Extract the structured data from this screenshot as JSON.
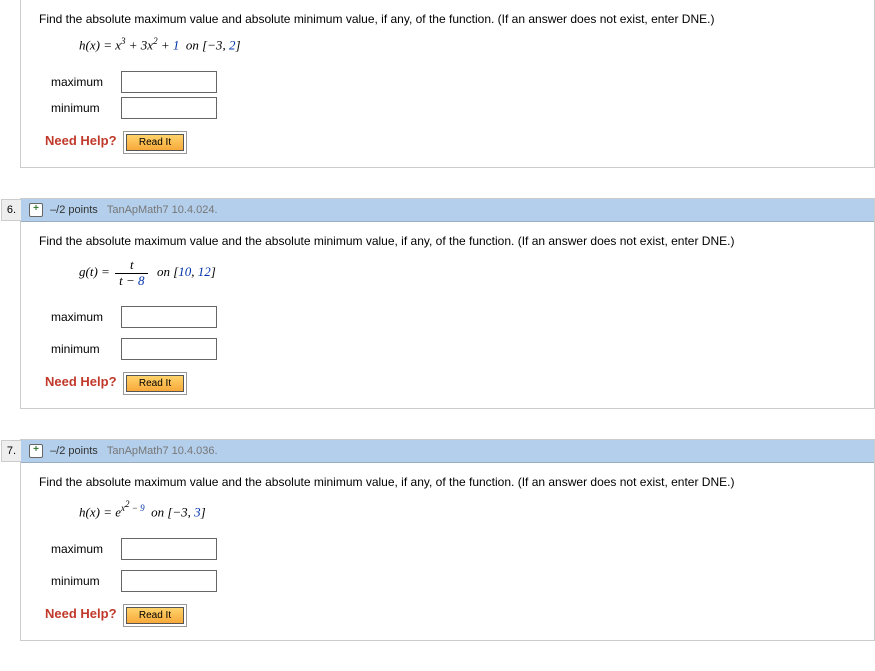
{
  "common": {
    "prompt_full": "Find the absolute maximum value and the absolute minimum value, if any, of the function. (If an answer does not exist, enter DNE.)",
    "prompt_short": "Find the absolute maximum value and absolute minimum value, if any, of the function. (If an answer does not exist, enter DNE.)",
    "max_label": "maximum",
    "min_label": "minimum",
    "help_label": "Need Help?",
    "read_it": "Read It"
  },
  "q5": {
    "func_name": "h(x)",
    "interval_a": "−3",
    "interval_b": "2"
  },
  "q6": {
    "number": "6.",
    "points": "–/2 points",
    "source": "TanApMath7 10.4.024.",
    "func_name": "g(t)",
    "num": "t",
    "den_a": "t",
    "den_b": "8",
    "interval_a": "10",
    "interval_b": "12"
  },
  "q7": {
    "number": "7.",
    "points": "–/2 points",
    "source": "TanApMath7 10.4.036.",
    "func_name": "h(x)",
    "exp_b": "9",
    "interval_a": "−3",
    "interval_b": "3"
  },
  "chart_data": {
    "type": "table",
    "questions": [
      {
        "id": "5_partial",
        "function": "h(x) = x^3 + 3x^2 + 1",
        "interval": "[-3, 2]",
        "fields": [
          "maximum",
          "minimum"
        ]
      },
      {
        "id": "6",
        "points": "-/2",
        "source": "TanApMath7 10.4.024",
        "function": "g(t) = t / (t - 8)",
        "interval": "[10, 12]",
        "fields": [
          "maximum",
          "minimum"
        ]
      },
      {
        "id": "7",
        "points": "-/2",
        "source": "TanApMath7 10.4.036",
        "function": "h(x) = e^(x^2 - 9)",
        "interval": "[-3, 3]",
        "fields": [
          "maximum",
          "minimum"
        ]
      }
    ]
  }
}
